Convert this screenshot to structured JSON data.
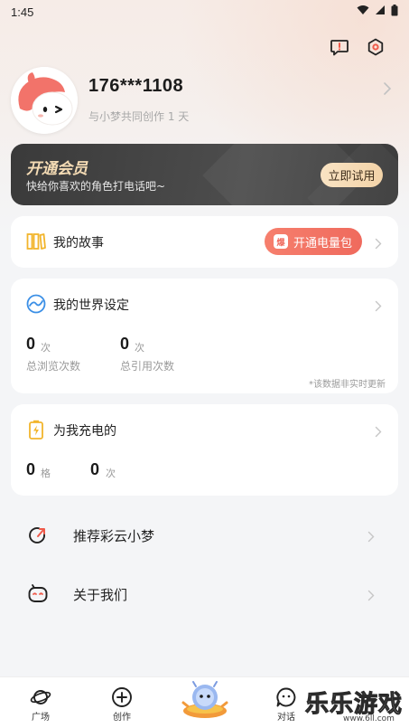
{
  "status_bar": {
    "time": "1:45"
  },
  "profile": {
    "username": "176***1108",
    "subtitle": "与小梦共同创作 1 天"
  },
  "vip": {
    "title": "开通会员",
    "description": "快给你喜欢的角色打电话吧~",
    "button": "立即试用"
  },
  "stories": {
    "title": "我的故事",
    "power_pack_label": "开通电量包",
    "power_pack_badge": "爆"
  },
  "world": {
    "title": "我的世界设定",
    "views": {
      "value": "0",
      "unit": "次",
      "label": "总浏览次数"
    },
    "quotes": {
      "value": "0",
      "unit": "次",
      "label": "总引用次数"
    },
    "note": "*该数据非实时更新"
  },
  "charge": {
    "title": "为我充电的",
    "cells": {
      "value": "0",
      "unit": "格"
    },
    "times": {
      "value": "0",
      "unit": "次"
    }
  },
  "menu": [
    {
      "label": "推荐彩云小梦",
      "icon": "share-icon"
    },
    {
      "label": "关于我们",
      "icon": "robot-face-icon"
    }
  ],
  "tabbar": {
    "tabs": [
      {
        "label": "广场",
        "icon": "planet-icon"
      },
      {
        "label": "创作",
        "icon": "plus-circle-icon"
      },
      {
        "label": "",
        "icon": "mascot-icon"
      },
      {
        "label": "对话",
        "icon": "chat-icon"
      }
    ]
  },
  "watermark": {
    "text": "乐乐游戏",
    "url": "www.6ll.com"
  },
  "colors": {
    "accent": "#ef6a5d",
    "vip_gold": "#f5dcb5",
    "page_bg": "#f4f5f7"
  }
}
